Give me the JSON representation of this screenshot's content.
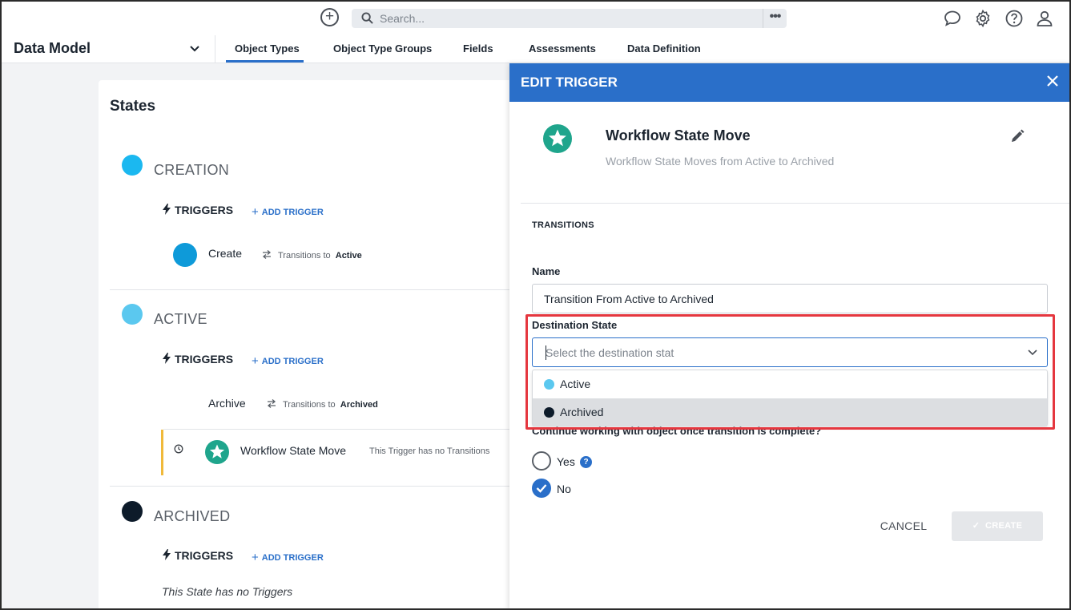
{
  "topbar": {
    "add_icon": "plus-circle-icon",
    "search_placeholder": "Search...",
    "more_label": "•••",
    "icons": [
      "chat-icon",
      "gear-icon",
      "help-icon",
      "user-icon"
    ]
  },
  "nav": {
    "module": "Data Model",
    "tabs": [
      {
        "label": "Object Types",
        "active": true
      },
      {
        "label": "Object Type Groups",
        "active": false
      },
      {
        "label": "Fields",
        "active": false
      },
      {
        "label": "Assessments",
        "active": false
      },
      {
        "label": "Data Definition",
        "active": false
      }
    ]
  },
  "states_card": {
    "title": "States",
    "triggers_label": "TRIGGERS",
    "add_trigger_label": "ADD TRIGGER",
    "transitions_to_label": "Transitions to",
    "states": [
      {
        "name": "CREATION",
        "color": "#1bb8f0",
        "triggers": [
          {
            "name": "Create",
            "target": "Active"
          }
        ]
      },
      {
        "name": "ACTIVE",
        "color": "#5bc8ef",
        "triggers": [
          {
            "name": "Archive",
            "target": "Archived"
          }
        ],
        "workflow_trigger": {
          "name": "Workflow State Move",
          "note": "This Trigger has no Transitions"
        }
      },
      {
        "name": "ARCHIVED",
        "color": "#0d1b2a",
        "empty_note": "This State has no Triggers"
      }
    ]
  },
  "panel": {
    "header": "EDIT TRIGGER",
    "trigger_name": "Workflow State Move",
    "trigger_description": "Workflow State Moves from Active to Archived",
    "section_label": "TRANSITIONS",
    "name_label": "Name",
    "name_value": "Transition From Active to Archived",
    "destination_label": "Destination State",
    "destination_placeholder": "Select the destination stat",
    "options": [
      {
        "label": "Active",
        "color": "#5bc8ef",
        "hovered": false
      },
      {
        "label": "Archived",
        "color": "#0d1b2a",
        "hovered": true
      }
    ],
    "continue_label": "Continue working with object once transition is complete?",
    "radio_yes": "Yes",
    "radio_no": "No",
    "selected_radio": "No",
    "cancel_label": "CANCEL",
    "create_label": "CREATE"
  },
  "colors": {
    "accent": "#2a6fc9",
    "highlight": "#e5373f",
    "teal": "#1fa58c",
    "warning_bar": "#f0b93a"
  }
}
